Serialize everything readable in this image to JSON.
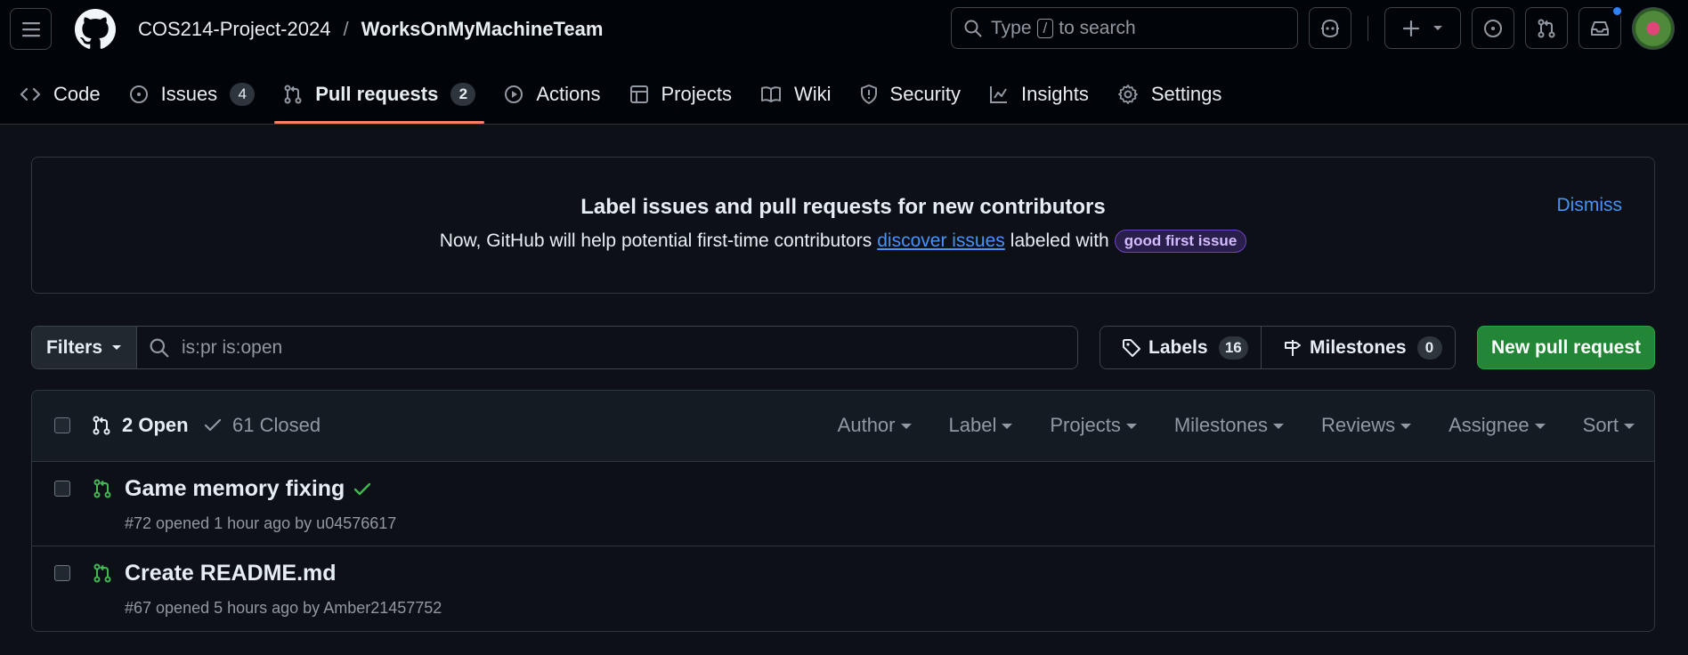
{
  "header": {
    "owner": "COS214-Project-2024",
    "separator": "/",
    "repo": "WorksOnMyMachineTeam",
    "search": {
      "prefix": "Type",
      "key": "/",
      "suffix": "to search"
    }
  },
  "nav": {
    "code": "Code",
    "issues": "Issues",
    "issues_count": "4",
    "pulls": "Pull requests",
    "pulls_count": "2",
    "actions": "Actions",
    "projects": "Projects",
    "wiki": "Wiki",
    "security": "Security",
    "insights": "Insights",
    "settings": "Settings"
  },
  "banner": {
    "title": "Label issues and pull requests for new contributors",
    "text_before": "Now, GitHub will help potential first-time contributors",
    "link": "discover issues",
    "text_after": "labeled with",
    "label": "good first issue",
    "dismiss": "Dismiss"
  },
  "filters": {
    "button": "Filters",
    "query": "is:pr is:open",
    "labels": "Labels",
    "labels_count": "16",
    "milestones": "Milestones",
    "milestones_count": "0",
    "new_pr": "New pull request"
  },
  "list": {
    "open": "2 Open",
    "closed": "61 Closed",
    "menus": {
      "author": "Author",
      "label": "Label",
      "projects": "Projects",
      "milestones": "Milestones",
      "reviews": "Reviews",
      "assignee": "Assignee",
      "sort": "Sort"
    },
    "items": [
      {
        "title": "Game memory fixing",
        "meta": "#72 opened 1 hour ago by u04576617",
        "status": "checks-passed"
      },
      {
        "title": "Create README.md",
        "meta": "#67 opened 5 hours ago by Amber21457752",
        "status": "none"
      }
    ]
  },
  "colors": {
    "accent_underline": "#f78166",
    "open_green": "#3fb950",
    "link_blue": "#4493f8",
    "primary_button": "#238636"
  }
}
